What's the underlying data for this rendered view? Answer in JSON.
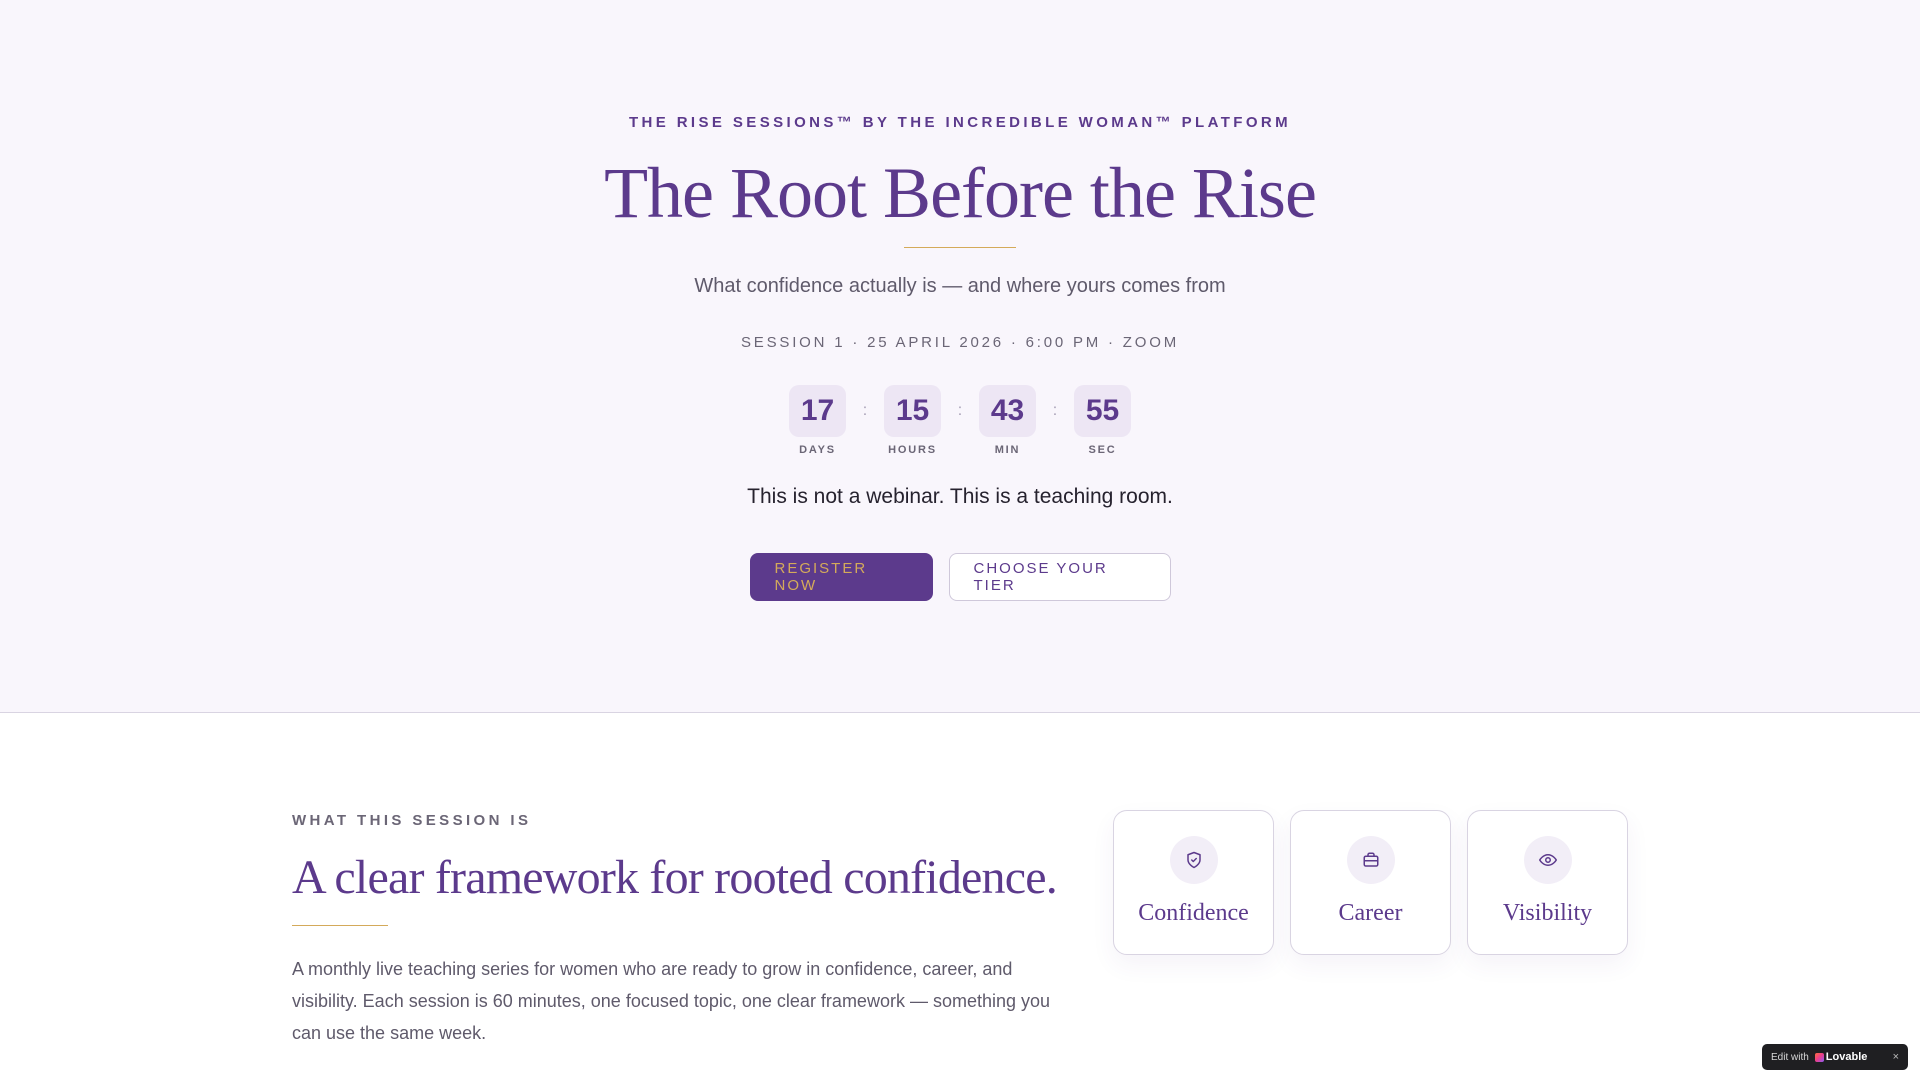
{
  "hero": {
    "eyebrow": "THE RISE SESSIONS™ BY THE INCREDIBLE WOMAN™ PLATFORM",
    "title": "The Root Before the Rise",
    "subtitle": "What confidence actually is — and where yours comes from",
    "session_line": "SESSION 1 · 25 APRIL 2026 · 6:00 PM · ZOOM",
    "countdown": [
      {
        "value": "17",
        "label": "DAYS"
      },
      {
        "value": "15",
        "label": "HOURS"
      },
      {
        "value": "43",
        "label": "MIN"
      },
      {
        "value": "55",
        "label": "SEC"
      }
    ],
    "countdown_separator": ":",
    "tagline": "This is not a webinar. This is a teaching room.",
    "primary_button": "REGISTER NOW",
    "secondary_button": "CHOOSE YOUR TIER"
  },
  "about": {
    "eyebrow": "WHAT THIS SESSION IS",
    "title": "A clear framework for rooted confidence.",
    "body": "A monthly live teaching series for women who are ready to grow in confidence, career, and visibility. Each session is 60 minutes, one focused topic, one clear framework — something you can use the same week.",
    "cards": [
      {
        "label": "Confidence",
        "icon": "shield-check-icon"
      },
      {
        "label": "Career",
        "icon": "briefcase-icon"
      },
      {
        "label": "Visibility",
        "icon": "eye-icon"
      }
    ]
  },
  "badge": {
    "prefix": "Edit with",
    "brand": "Lovable",
    "close": "×"
  },
  "colors": {
    "primary": "#5c3a8c",
    "gold": "#d4aa5a",
    "hero_bg": "#f9f6fc"
  }
}
